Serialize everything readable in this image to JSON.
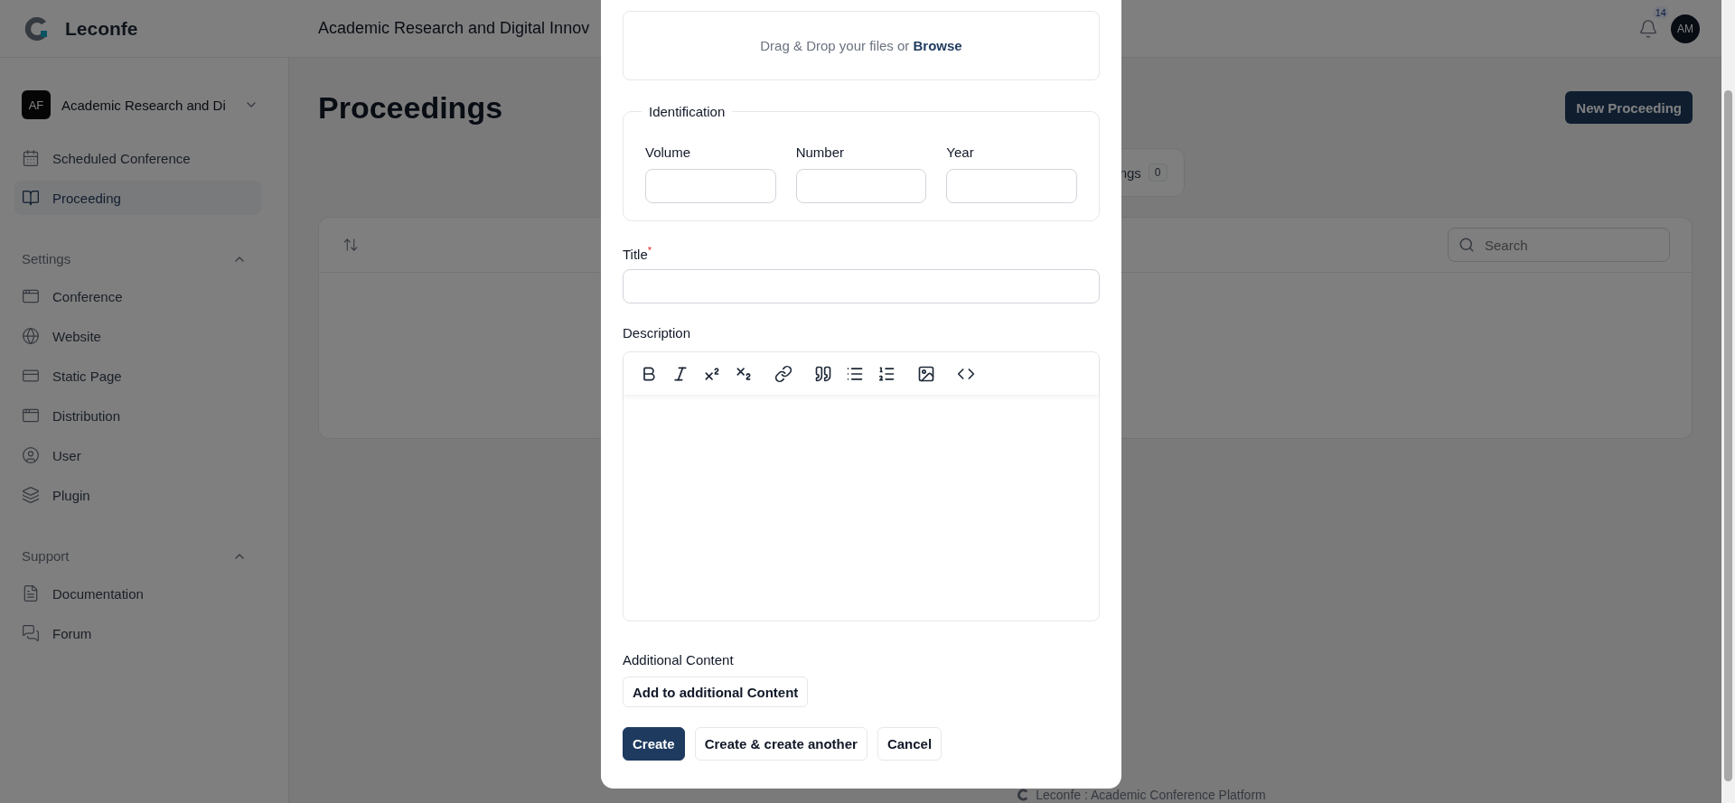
{
  "header": {
    "brand": "Leconfe",
    "title": "Academic Research and Digital Innov",
    "notification_count": "14",
    "avatar": "AM"
  },
  "sidebar": {
    "switcher": {
      "initials": "AF",
      "name": "Academic Research and Di"
    },
    "items": [
      {
        "label": "Scheduled Conference",
        "selected": false
      },
      {
        "label": "Proceeding",
        "selected": true
      }
    ],
    "groups": [
      {
        "title": "Settings",
        "expanded": true,
        "items": [
          {
            "label": "Conference",
            "selected": false
          },
          {
            "label": "Website",
            "selected": false
          },
          {
            "label": "Static Page",
            "selected": false
          },
          {
            "label": "Distribution",
            "selected": false
          },
          {
            "label": "User",
            "selected": false
          },
          {
            "label": "Plugin",
            "selected": false
          }
        ]
      },
      {
        "title": "Support",
        "expanded": true,
        "items": [
          {
            "label": "Documentation",
            "selected": false
          },
          {
            "label": "Forum",
            "selected": false
          }
        ]
      }
    ]
  },
  "page": {
    "heading": "Proceedings",
    "new_button": "New Proceeding",
    "tabs": [
      {
        "label": "ngs",
        "count": "0"
      }
    ],
    "search": {
      "placeholder": "Search"
    }
  },
  "footer": "Leconfe : Academic Conference Platform",
  "modal": {
    "upload": {
      "text": "Drag & Drop your files or",
      "link": "Browse"
    },
    "identification": {
      "legend": "Identification",
      "fields": [
        {
          "label": "Volume"
        },
        {
          "label": "Number"
        },
        {
          "label": "Year"
        }
      ]
    },
    "title_field": {
      "label": "Title",
      "required_mark": "*"
    },
    "description": {
      "label": "Description"
    },
    "additional": {
      "label": "Additional Content",
      "button": "Add to additional Content"
    },
    "actions": [
      {
        "label": "Create",
        "kind": "primary"
      },
      {
        "label": "Create & create another",
        "kind": "secondary"
      },
      {
        "label": "Cancel",
        "kind": "secondary"
      }
    ]
  }
}
